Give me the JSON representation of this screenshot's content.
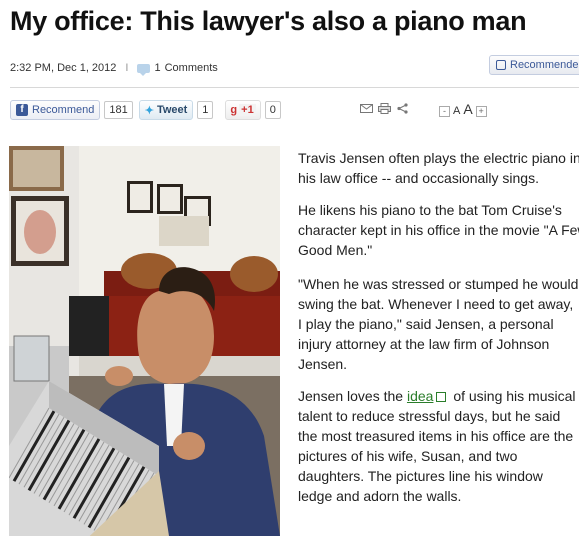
{
  "headline": "My office: This lawyer's also a piano man",
  "meta": {
    "timestamp": "2:32 PM, Dec 1, 2012",
    "separator": "I",
    "comment_count": "1",
    "comments_label": "Comments"
  },
  "recommend_top_label": "Recommended",
  "share": {
    "fb_label": "Recommend",
    "fb_count": "181",
    "tweet_label": "Tweet",
    "tweet_count": "1",
    "gplus_label": "+1",
    "gplus_count": "0"
  },
  "tools": {
    "icons": [
      "email-icon",
      "print-icon",
      "share-icon"
    ]
  },
  "text_size": {
    "minus": "-",
    "small": "A",
    "large": "A",
    "plus": "+"
  },
  "article": {
    "p1": "Travis Jensen often plays the electric piano in his law office -- and occasionally sings.",
    "p2": "He likens his piano to the bat Tom Cruise's character kept in his office in the movie \"A Few Good Men.\"",
    "p3_line1": "\"When he was stressed or stumped he would",
    "p3_line2": "swing the bat. Whenever I need to get away,",
    "p3_line3": "I play the piano,\" said Jensen, a personal",
    "p3_line4": "injury attorney at the law firm of Johnson",
    "p3_line5": "Jensen.",
    "p4_before": "Jensen loves the ",
    "p4_link": "idea",
    "p4_after": " of using his musical talent to reduce stressful days, but he said the most treasured items in his office are the pictures of his wife, Susan, and two daughters. The pictures line his window ledge and adorn the walls."
  },
  "colors": {
    "facebook": "#3b5998",
    "twitter": "#33a3dc",
    "link_green": "#2a7d2a"
  }
}
